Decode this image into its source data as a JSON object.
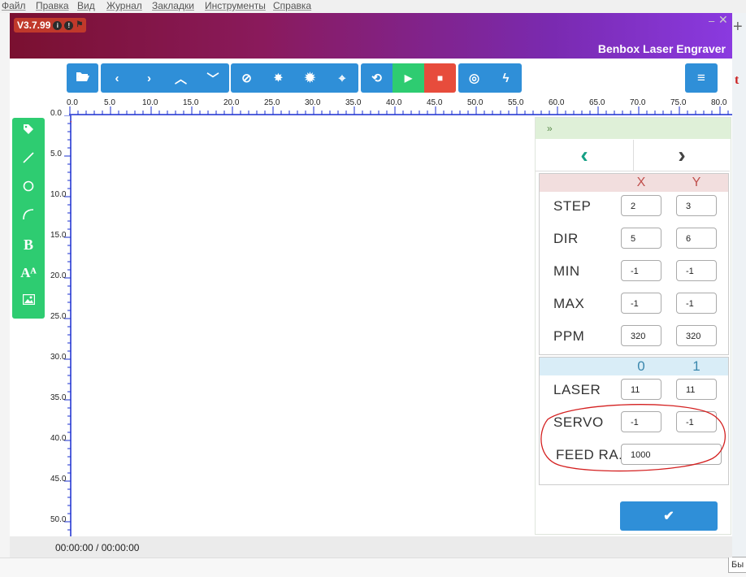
{
  "menubar": {
    "items": [
      "Файл",
      "Правка",
      "Вид",
      "Журнал",
      "Закладки",
      "Инструменты",
      "Справка"
    ]
  },
  "app": {
    "version": "V3.7.99",
    "title": "Benbox Laser Engraver",
    "window_controls": {
      "minimize": "–",
      "close": "✕"
    }
  },
  "toolbar": {
    "buttons": [
      {
        "name": "open",
        "icon": "folder-open-icon"
      },
      {
        "name": "move-left",
        "icon": "chevron-left-icon"
      },
      {
        "name": "move-right",
        "icon": "chevron-right-icon"
      },
      {
        "name": "move-up",
        "icon": "chevron-up-icon"
      },
      {
        "name": "move-down",
        "icon": "chevron-down-icon"
      },
      {
        "name": "stop-sign",
        "icon": "ban-icon"
      },
      {
        "name": "laser-weak",
        "icon": "sun-small-icon"
      },
      {
        "name": "laser-strong",
        "icon": "sun-large-icon"
      },
      {
        "name": "center",
        "icon": "crosshair-icon"
      },
      {
        "name": "repeat",
        "icon": "repeat-icon"
      },
      {
        "name": "play",
        "icon": "play-icon"
      },
      {
        "name": "stop",
        "icon": "stop-icon"
      },
      {
        "name": "settings",
        "icon": "target-icon"
      },
      {
        "name": "flash",
        "icon": "bolt-icon"
      },
      {
        "name": "menu",
        "icon": "hamburger-icon"
      }
    ]
  },
  "ruler": {
    "h_labels": [
      "0.0",
      "5.0",
      "10.0",
      "15.0",
      "20.0",
      "25.0",
      "30.0",
      "35.0",
      "40.0",
      "45.0",
      "50.0",
      "55.0",
      "60.0",
      "65.0",
      "70.0",
      "75.0",
      "80.0"
    ],
    "v_labels": [
      "0.0",
      "5.0",
      "10.0",
      "15.0",
      "20.0",
      "25.0",
      "30.0",
      "35.0",
      "40.0",
      "45.0",
      "50.0"
    ]
  },
  "tools": [
    {
      "name": "tag",
      "icon": "tag-icon",
      "glyph": "⬥"
    },
    {
      "name": "line",
      "icon": "line-icon",
      "glyph": "╱"
    },
    {
      "name": "circle",
      "icon": "circle-icon",
      "glyph": "○"
    },
    {
      "name": "arc",
      "icon": "arc-icon",
      "glyph": "◜"
    },
    {
      "name": "bold-text",
      "icon": "bold-icon",
      "glyph": "B"
    },
    {
      "name": "font-text",
      "icon": "font-icon",
      "glyph": "Aᴬ"
    },
    {
      "name": "image",
      "icon": "image-icon",
      "glyph": "▣"
    }
  ],
  "panel": {
    "header": "»",
    "tab_prev": "‹",
    "tab_next": "›",
    "axes_group": {
      "col_x": "X",
      "col_y": "Y",
      "rows": [
        {
          "label": "STEP",
          "x": "2",
          "y": "3"
        },
        {
          "label": "DIR",
          "x": "5",
          "y": "6"
        },
        {
          "label": "MIN",
          "x": "-1",
          "y": "-1"
        },
        {
          "label": "MAX",
          "x": "-1",
          "y": "-1"
        },
        {
          "label": "PPM",
          "x": "320",
          "y": "320"
        }
      ]
    },
    "io_group": {
      "col_0": "0",
      "col_1": "1",
      "rows": [
        {
          "label": "LASER",
          "v0": "11",
          "v1": "11"
        },
        {
          "label": "SERVO",
          "v0": "-1",
          "v1": "-1"
        }
      ],
      "feed_label": "FEED RA..",
      "feed_value": "1000"
    },
    "confirm_icon": "check-icon"
  },
  "status": {
    "time": "00:00:00 / 00:00:00"
  },
  "colors": {
    "accent_blue": "#2f8fd8",
    "accent_green": "#2ecc71",
    "accent_red": "#e74c3c",
    "annotation": "#d42020"
  },
  "edge": {
    "right_glyph": "+",
    "right_t": "t",
    "bottom_chip": "Бы"
  }
}
